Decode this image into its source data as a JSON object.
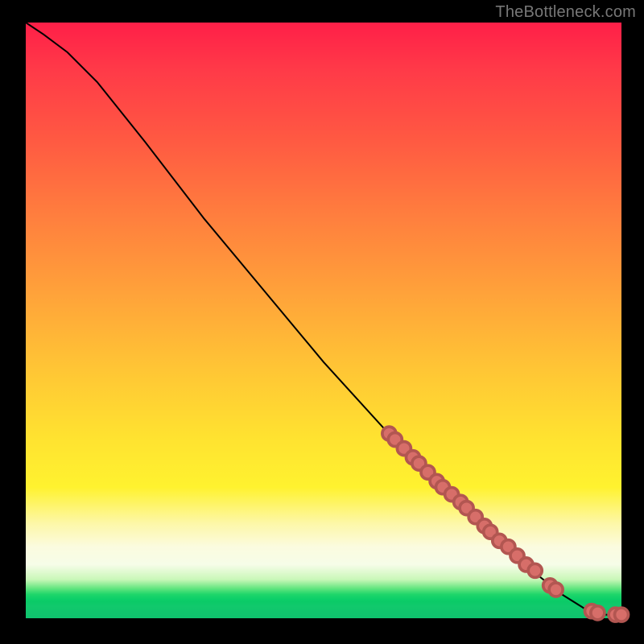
{
  "attribution": "TheBottleneck.com",
  "chart_data": {
    "type": "line",
    "title": "",
    "xlabel": "",
    "ylabel": "",
    "xlim": [
      0,
      100
    ],
    "ylim": [
      0,
      100
    ],
    "curve": [
      {
        "x": 0,
        "y": 100
      },
      {
        "x": 3,
        "y": 98
      },
      {
        "x": 7,
        "y": 95
      },
      {
        "x": 12,
        "y": 90
      },
      {
        "x": 20,
        "y": 80
      },
      {
        "x": 30,
        "y": 67
      },
      {
        "x": 40,
        "y": 55
      },
      {
        "x": 50,
        "y": 43
      },
      {
        "x": 60,
        "y": 32
      },
      {
        "x": 70,
        "y": 22
      },
      {
        "x": 78,
        "y": 14
      },
      {
        "x": 85,
        "y": 8
      },
      {
        "x": 90,
        "y": 4
      },
      {
        "x": 94,
        "y": 1.5
      },
      {
        "x": 97,
        "y": 0.6
      },
      {
        "x": 100,
        "y": 0.5
      }
    ],
    "markers": [
      {
        "x": 61,
        "y": 31
      },
      {
        "x": 62,
        "y": 30
      },
      {
        "x": 63.5,
        "y": 28.5
      },
      {
        "x": 65,
        "y": 27
      },
      {
        "x": 66,
        "y": 26
      },
      {
        "x": 67.5,
        "y": 24.5
      },
      {
        "x": 69,
        "y": 23
      },
      {
        "x": 70,
        "y": 22
      },
      {
        "x": 71.5,
        "y": 20.8
      },
      {
        "x": 73,
        "y": 19.5
      },
      {
        "x": 74,
        "y": 18.5
      },
      {
        "x": 75.5,
        "y": 17
      },
      {
        "x": 77,
        "y": 15.5
      },
      {
        "x": 78,
        "y": 14.5
      },
      {
        "x": 79.5,
        "y": 13
      },
      {
        "x": 81,
        "y": 12
      },
      {
        "x": 82.5,
        "y": 10.5
      },
      {
        "x": 84,
        "y": 9
      },
      {
        "x": 85.5,
        "y": 8
      },
      {
        "x": 88,
        "y": 5.5
      },
      {
        "x": 89,
        "y": 4.8
      },
      {
        "x": 95,
        "y": 1.2
      },
      {
        "x": 96,
        "y": 0.9
      },
      {
        "x": 99,
        "y": 0.6
      },
      {
        "x": 100,
        "y": 0.6
      }
    ]
  },
  "colors": {
    "marker_fill": "#d76e69",
    "marker_stroke": "#b25651",
    "curve": "#000000"
  }
}
